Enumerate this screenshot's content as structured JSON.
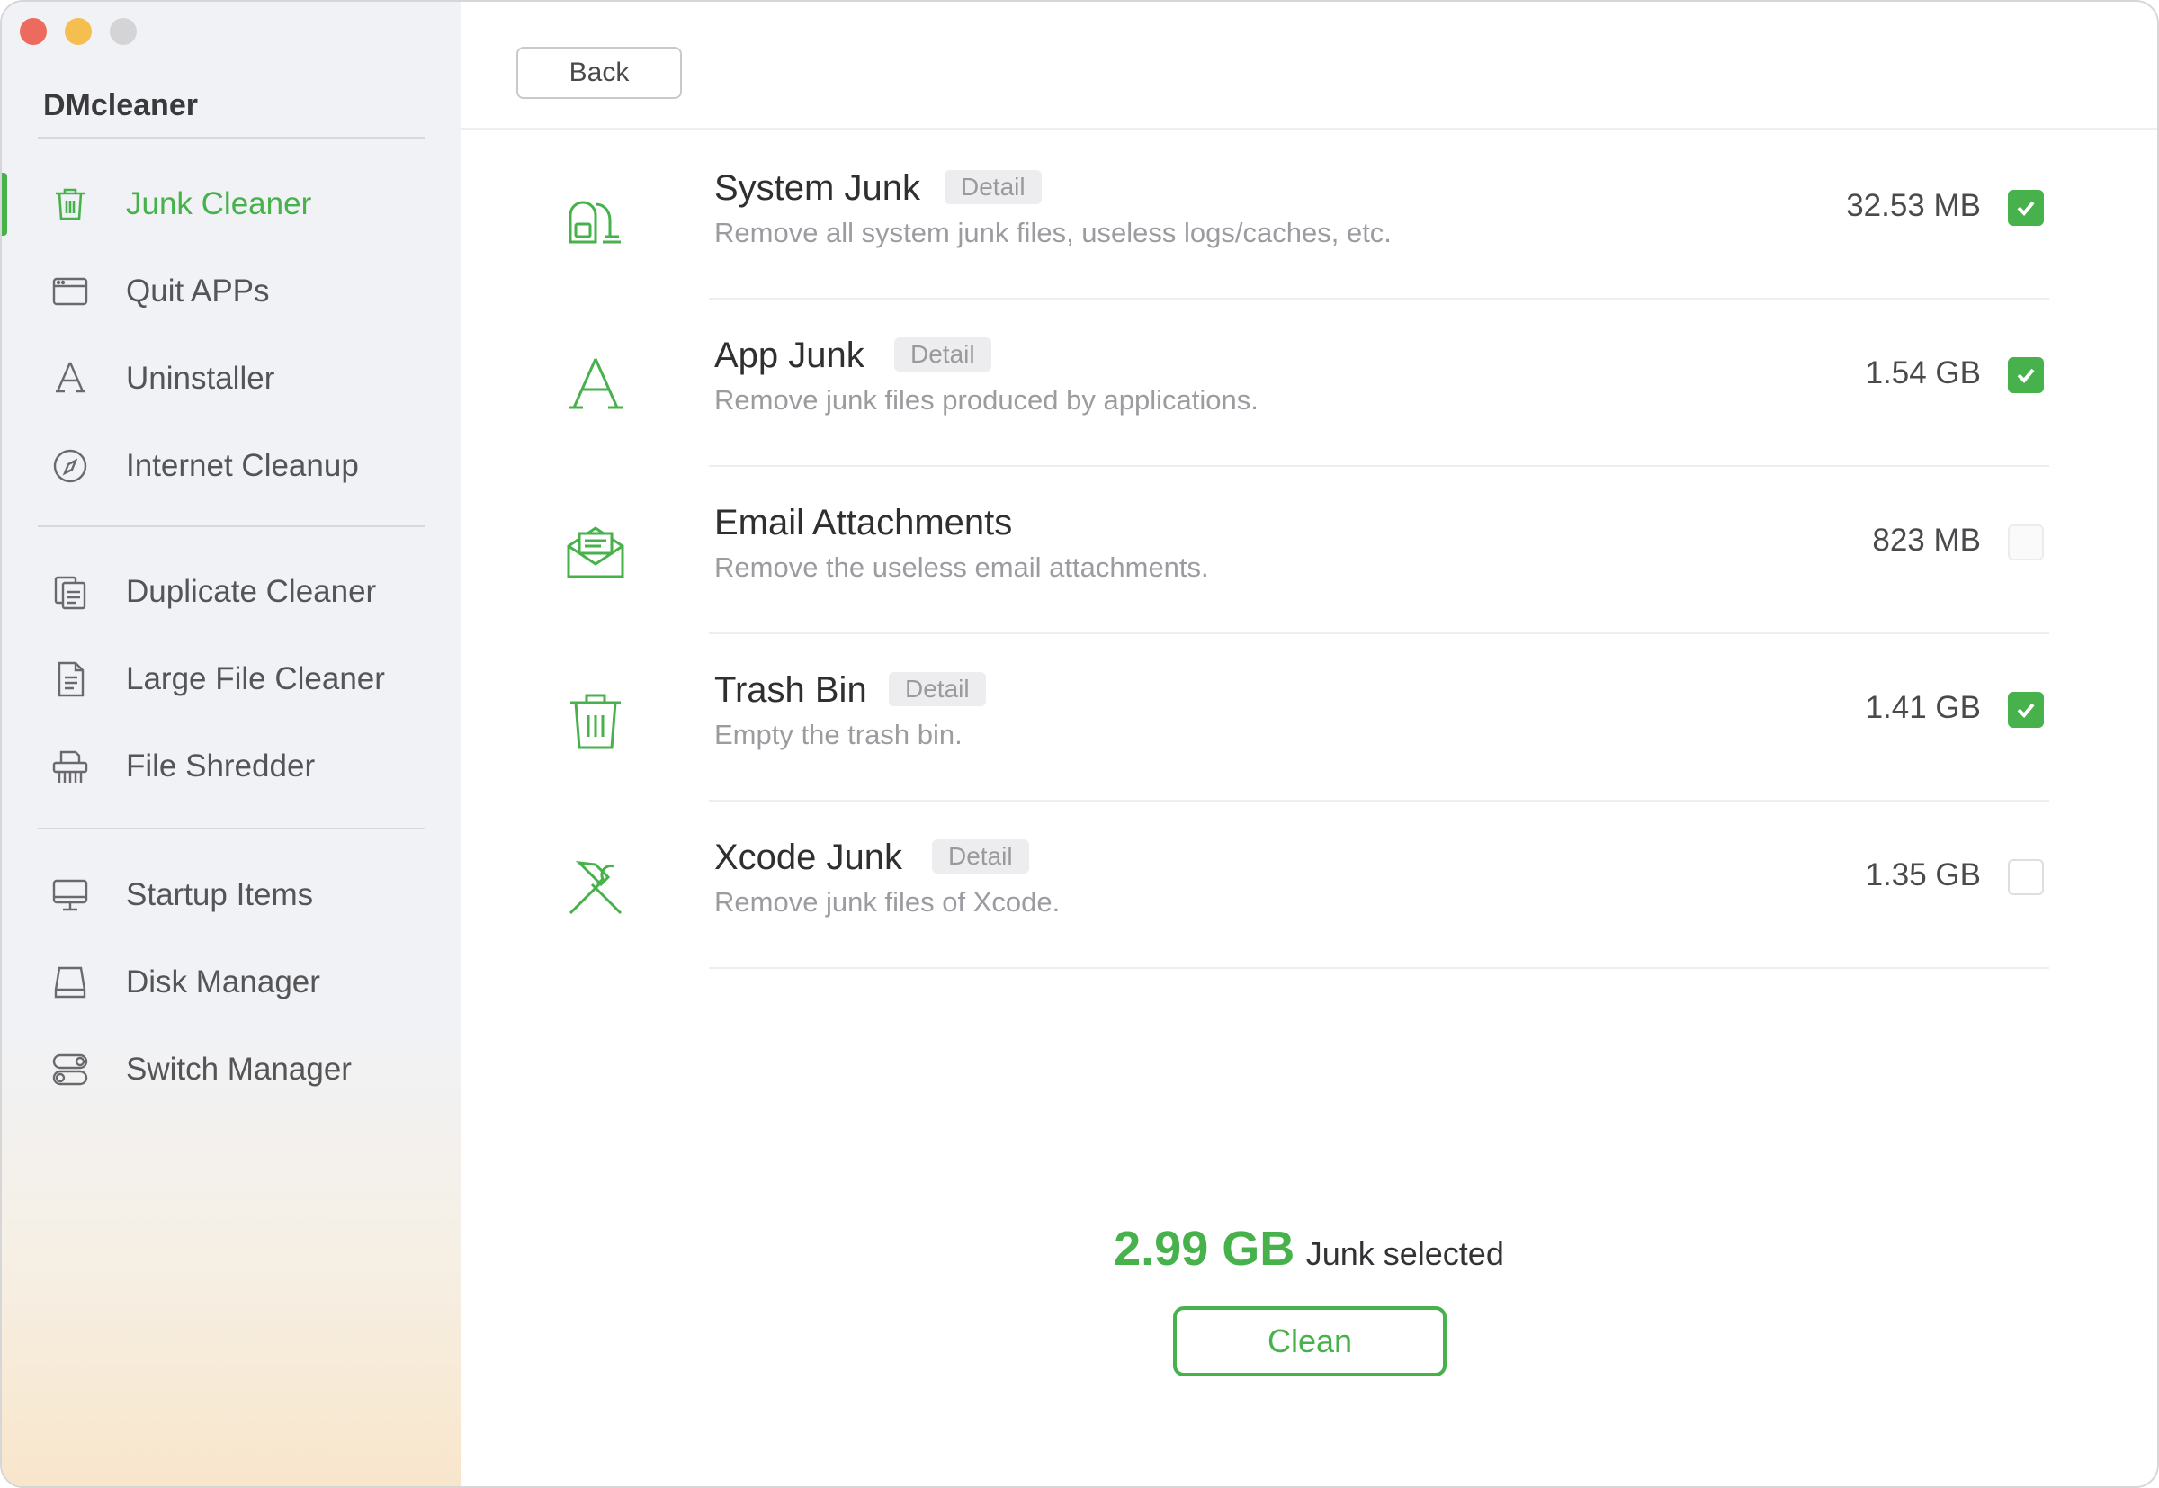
{
  "app": {
    "title": "DMcleaner"
  },
  "sidebar": {
    "items": [
      {
        "label": "Junk Cleaner",
        "icon": "trash-icon",
        "active": true
      },
      {
        "label": "Quit APPs",
        "icon": "window-icon"
      },
      {
        "label": "Uninstaller",
        "icon": "app-store-icon"
      },
      {
        "label": "Internet Cleanup",
        "icon": "compass-icon"
      },
      {
        "label": "Duplicate Cleaner",
        "icon": "duplicate-docs-icon"
      },
      {
        "label": "Large File Cleaner",
        "icon": "document-icon"
      },
      {
        "label": "File Shredder",
        "icon": "shredder-icon"
      },
      {
        "label": "Startup Items",
        "icon": "monitor-icon"
      },
      {
        "label": "Disk Manager",
        "icon": "disk-icon"
      },
      {
        "label": "Switch Manager",
        "icon": "toggle-icon"
      }
    ]
  },
  "toolbar": {
    "back_label": "Back"
  },
  "junk_items": [
    {
      "title": "System Junk",
      "detail": "Detail",
      "desc": "Remove all system junk files, useless logs/caches, etc.",
      "size": "32.53 MB",
      "checked": true,
      "icon": "vacuum-icon"
    },
    {
      "title": "App Junk",
      "detail": "Detail",
      "desc": "Remove junk files produced by applications.",
      "size": "1.54 GB",
      "checked": true,
      "icon": "app-store-icon"
    },
    {
      "title": "Email Attachments",
      "detail": "",
      "desc": "Remove the useless email attachments.",
      "size": "823 MB",
      "checked": false,
      "disabled": true,
      "icon": "envelope-icon"
    },
    {
      "title": "Trash Bin",
      "detail": "Detail",
      "desc": "Empty the trash bin.",
      "size": "1.41 GB",
      "checked": true,
      "icon": "trash-icon"
    },
    {
      "title": "Xcode Junk",
      "detail": "Detail",
      "desc": "Remove junk files of Xcode.",
      "size": "1.35 GB",
      "checked": false,
      "icon": "hammer-icon"
    }
  ],
  "summary": {
    "amount": "2.99 GB",
    "label": "Junk selected"
  },
  "actions": {
    "clean_label": "Clean"
  },
  "colors": {
    "accent": "#47b14b",
    "sidebar_bg": "#f1f2f5"
  }
}
